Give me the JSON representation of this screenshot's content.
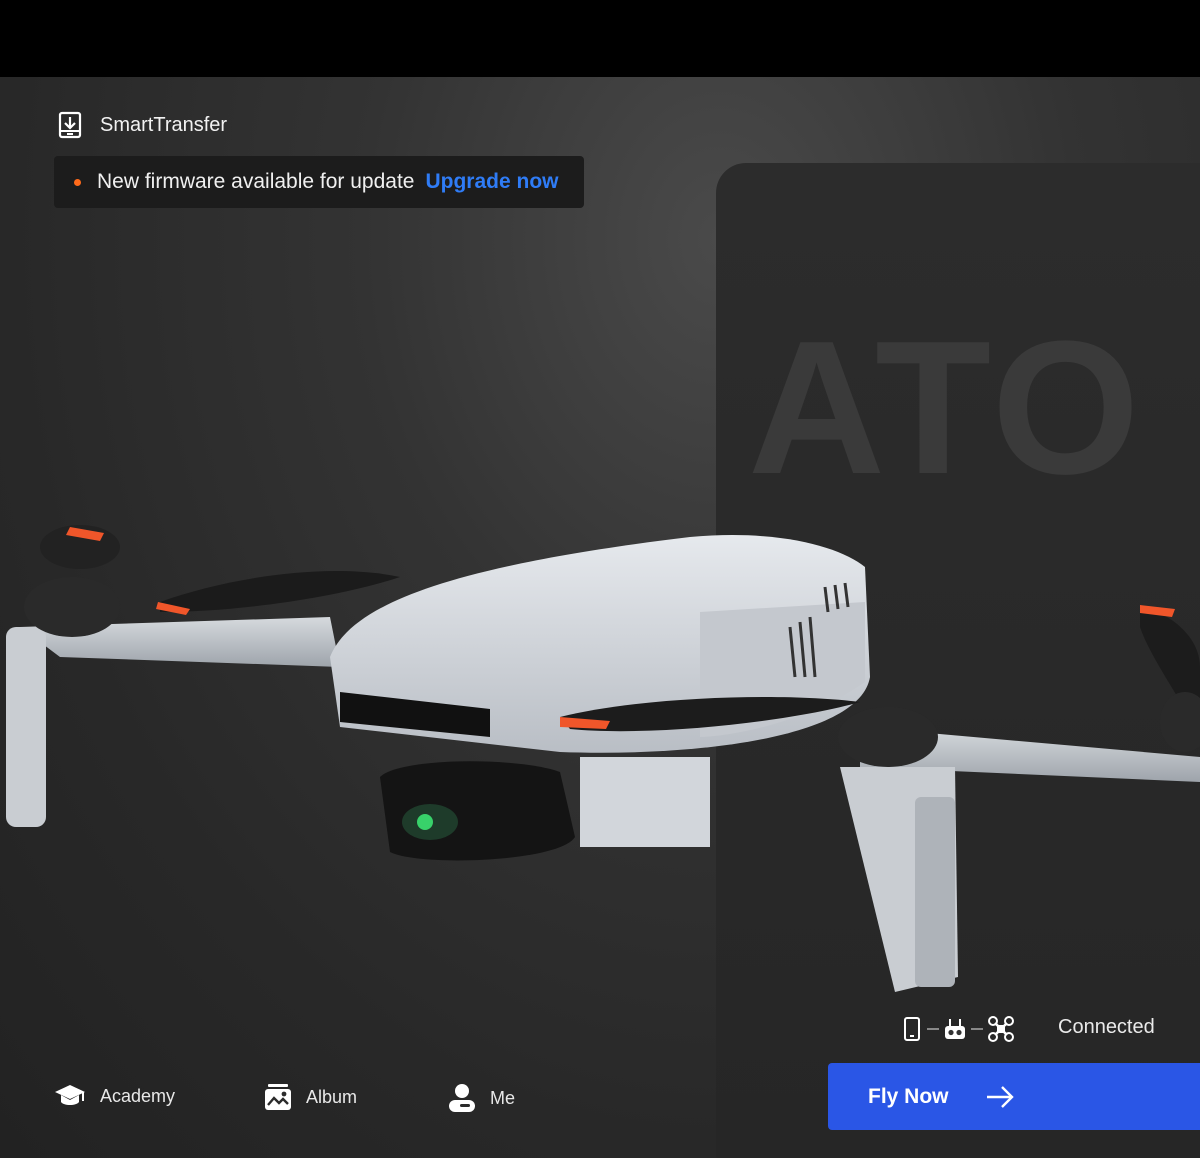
{
  "header": {
    "smart_transfer_label": "SmartTransfer",
    "smart_transfer_icon": "download-device-icon"
  },
  "firmware_banner": {
    "message": "New firmware available for update",
    "link": "Upgrade now",
    "dot_color": "#ff6a1a",
    "link_color": "#2f7cf6"
  },
  "product": {
    "watermark": "ATO"
  },
  "connection": {
    "status": "Connected",
    "icons": [
      "phone-icon",
      "remote-controller-icon",
      "drone-icon"
    ]
  },
  "fly_button": {
    "label": "Fly Now",
    "color": "#2a56e6"
  },
  "bottom_nav": [
    {
      "label": "Academy",
      "icon": "graduation-cap-icon"
    },
    {
      "label": "Album",
      "icon": "album-icon"
    },
    {
      "label": "Me",
      "icon": "user-icon"
    }
  ]
}
